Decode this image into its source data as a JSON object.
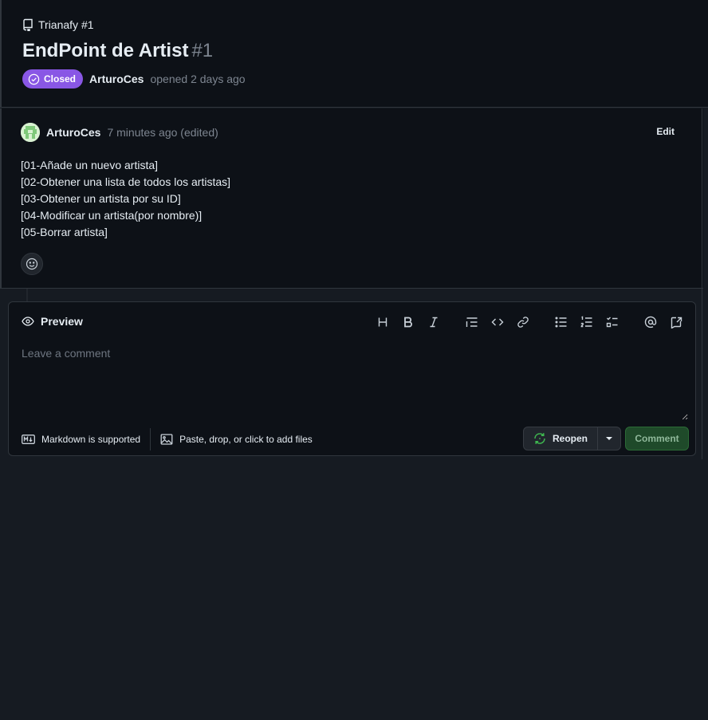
{
  "issue": {
    "repo_ref": "Trianafy #1",
    "title": "EndPoint de Artist",
    "number": "#1",
    "state_label": "Closed",
    "author": "ArturoCes",
    "opened_text": "opened 2 days ago"
  },
  "comment": {
    "author": "ArturoCes",
    "meta": "7 minutes ago (edited)",
    "edit_label": "Edit",
    "lines": [
      "[01-Añade un nuevo artista]",
      "[02-Obtener una lista de todos los artistas]",
      "[03-Obtener un artista por su ID]",
      "[04-Modificar un artista(por nombre)]",
      "[05-Borrar artista]"
    ]
  },
  "editor": {
    "tab_label": "Preview",
    "placeholder": "Leave a comment",
    "markdown_label": "Markdown is supported",
    "attach_label": "Paste, drop, or click to add files",
    "reopen_label": "Reopen",
    "comment_label": "Comment"
  },
  "toolbar_icons": [
    "heading-icon",
    "bold-icon",
    "italic-icon",
    "quote-icon",
    "code-icon",
    "link-icon",
    "unordered-list-icon",
    "ordered-list-icon",
    "task-list-icon",
    "mention-icon",
    "reference-icon"
  ],
  "colors": {
    "closed_badge": "#8957e5",
    "comment_button_bg": "#1f4a2a",
    "reopen_icon": "#3fb950",
    "page_bg": "#161b22",
    "panel_bg": "#0d1117"
  }
}
